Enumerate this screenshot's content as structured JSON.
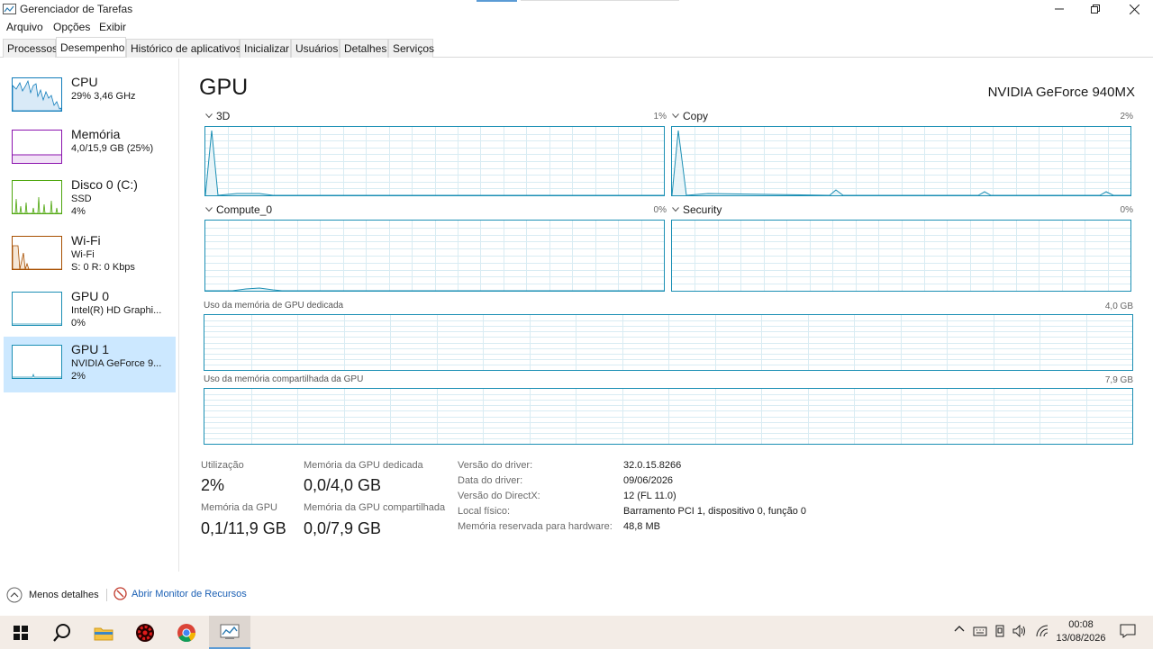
{
  "window": {
    "title": "Gerenciador de Tarefas"
  },
  "menu": {
    "items": [
      "Arquivo",
      "Opções",
      "Exibir"
    ]
  },
  "tabs": [
    "Processos",
    "Desempenho",
    "Histórico de aplicativos",
    "Inicializar",
    "Usuários",
    "Detalhes",
    "Serviços"
  ],
  "sidebar": {
    "items": [
      {
        "name": "CPU",
        "line1": "29%  3,46 GHz",
        "line2": ""
      },
      {
        "name": "Memória",
        "line1": "4,0/15,9 GB (25%)",
        "line2": ""
      },
      {
        "name": "Disco 0 (C:)",
        "line1": "SSD",
        "line2": "4%"
      },
      {
        "name": "Wi-Fi",
        "line1": "Wi-Fi",
        "line2": "S: 0  R: 0 Kbps"
      },
      {
        "name": "GPU 0",
        "line1": "Intel(R) HD Graphi...",
        "line2": "0%"
      },
      {
        "name": "GPU 1",
        "line1": "NVIDIA GeForce 9...",
        "line2": "2%"
      }
    ],
    "colors": {
      "cpu": "#117dbb",
      "memory": "#8b12ae",
      "disk": "#4da60c",
      "wifi": "#a74f01",
      "gpu": "#1b8fb4"
    }
  },
  "main": {
    "title": "GPU",
    "device": "NVIDIA GeForce 940MX",
    "engines": [
      {
        "name": "3D",
        "value": "1%"
      },
      {
        "name": "Copy",
        "value": "2%"
      },
      {
        "name": "Compute_0",
        "value": "0%"
      },
      {
        "name": "Security",
        "value": "0%"
      }
    ],
    "dedicated_memory": {
      "label": "Uso da memória de GPU dedicada",
      "max": "4,0 GB"
    },
    "shared_memory": {
      "label": "Uso da memória compartilhada da GPU",
      "max": "7,9 GB"
    },
    "stats": {
      "utilization_label": "Utilização",
      "utilization_value": "2%",
      "dedicated_label": "Memória da GPU dedicada",
      "dedicated_value": "0,0/4,0 GB",
      "gpu_memory_label": "Memória da GPU",
      "gpu_memory_value": "0,1/11,9 GB",
      "shared_label": "Memória da GPU compartilhada",
      "shared_value": "0,0/7,9 GB"
    },
    "properties": [
      {
        "label": "Versão do driver:",
        "value": "32.0.15.8266"
      },
      {
        "label": "Data do driver:",
        "value": "09/06/2026"
      },
      {
        "label": "Versão do DirectX:",
        "value": "12 (FL 11.0)"
      },
      {
        "label": "Local físico:",
        "value": "Barramento PCI 1, dispositivo 0, função 0"
      },
      {
        "label": "Memória reservada para hardware:",
        "value": "48,8 MB"
      }
    ]
  },
  "footer": {
    "fewer_details": "Menos detalhes",
    "resource_monitor": "Abrir Monitor de Recursos"
  },
  "taskbar": {
    "time": "00:08",
    "date": "13/08/2026"
  }
}
